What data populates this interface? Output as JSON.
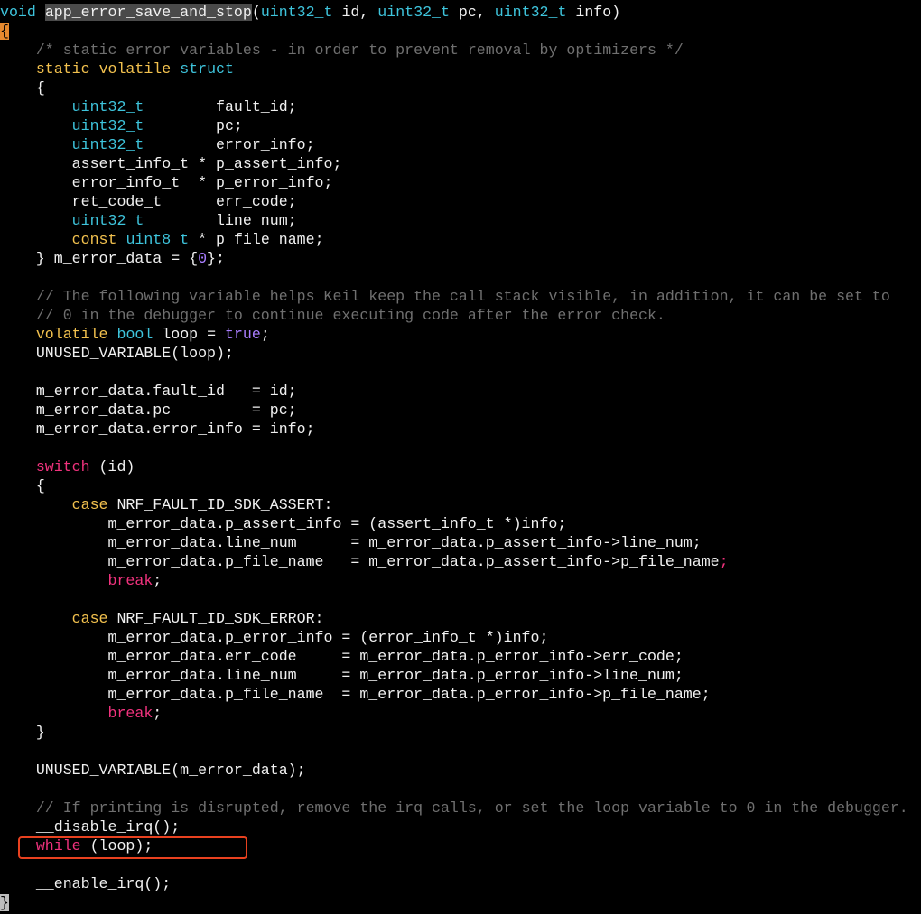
{
  "colors": {
    "background": "#000000",
    "plain": "#f0f0f0",
    "keyword": "#f2c14e",
    "type": "#3ec4dc",
    "control": "#f0327d",
    "comment": "#6f6f6f",
    "constant": "#a97dff",
    "cursor": "#e6892e",
    "annotation_box": "#e8411f"
  },
  "code_lines": [
    [
      [
        "ty",
        "void"
      ],
      [
        "pl",
        " "
      ],
      [
        "fn",
        "app_error_save_and_stop"
      ],
      [
        "pl",
        "("
      ],
      [
        "ty",
        "uint32_t"
      ],
      [
        "pl",
        " id, "
      ],
      [
        "ty",
        "uint32_t"
      ],
      [
        "pl",
        " pc, "
      ],
      [
        "ty",
        "uint32_t"
      ],
      [
        "pl",
        " info)"
      ]
    ],
    [
      [
        "cursor",
        "{"
      ]
    ],
    [
      [
        "pl",
        "    "
      ],
      [
        "cm",
        "/* static error variables - in order to prevent removal by optimizers */"
      ]
    ],
    [
      [
        "pl",
        "    "
      ],
      [
        "kw",
        "static"
      ],
      [
        "pl",
        " "
      ],
      [
        "kw",
        "volatile"
      ],
      [
        "pl",
        " "
      ],
      [
        "ty",
        "struct"
      ]
    ],
    [
      [
        "pl",
        "    {"
      ]
    ],
    [
      [
        "pl",
        "        "
      ],
      [
        "ty",
        "uint32_t"
      ],
      [
        "pl",
        "        fault_id;"
      ]
    ],
    [
      [
        "pl",
        "        "
      ],
      [
        "ty",
        "uint32_t"
      ],
      [
        "pl",
        "        pc;"
      ]
    ],
    [
      [
        "pl",
        "        "
      ],
      [
        "ty",
        "uint32_t"
      ],
      [
        "pl",
        "        error_info;"
      ]
    ],
    [
      [
        "pl",
        "        assert_info_t * p_assert_info;"
      ]
    ],
    [
      [
        "pl",
        "        error_info_t  * p_error_info;"
      ]
    ],
    [
      [
        "pl",
        "        ret_code_t      err_code;"
      ]
    ],
    [
      [
        "pl",
        "        "
      ],
      [
        "ty",
        "uint32_t"
      ],
      [
        "pl",
        "        line_num;"
      ]
    ],
    [
      [
        "pl",
        "        "
      ],
      [
        "kw",
        "const"
      ],
      [
        "pl",
        " "
      ],
      [
        "ty",
        "uint8_t"
      ],
      [
        "pl",
        " * p_file_name;"
      ]
    ],
    [
      [
        "pl",
        "    } m_error_data = {"
      ],
      [
        "ct",
        "0"
      ],
      [
        "pl",
        "};"
      ]
    ],
    [
      [
        "pl",
        ""
      ]
    ],
    [
      [
        "pl",
        "    "
      ],
      [
        "cm",
        "// The following variable helps Keil keep the call stack visible, in addition, it can be set to"
      ]
    ],
    [
      [
        "pl",
        "    "
      ],
      [
        "cm",
        "// 0 in the debugger to continue executing code after the error check."
      ]
    ],
    [
      [
        "pl",
        "    "
      ],
      [
        "kw",
        "volatile"
      ],
      [
        "pl",
        " "
      ],
      [
        "ty",
        "bool"
      ],
      [
        "pl",
        " loop = "
      ],
      [
        "ct",
        "true"
      ],
      [
        "pl",
        ";"
      ]
    ],
    [
      [
        "pl",
        "    UNUSED_VARIABLE(loop);"
      ]
    ],
    [
      [
        "pl",
        ""
      ]
    ],
    [
      [
        "pl",
        "    m_error_data.fault_id   = id;"
      ]
    ],
    [
      [
        "pl",
        "    m_error_data.pc         = pc;"
      ]
    ],
    [
      [
        "pl",
        "    m_error_data.error_info = info;"
      ]
    ],
    [
      [
        "pl",
        ""
      ]
    ],
    [
      [
        "pl",
        "    "
      ],
      [
        "ctl",
        "switch"
      ],
      [
        "pl",
        " (id)"
      ]
    ],
    [
      [
        "pl",
        "    {"
      ]
    ],
    [
      [
        "pl",
        "        "
      ],
      [
        "kw",
        "case"
      ],
      [
        "pl",
        " NRF_FAULT_ID_SDK_ASSERT:"
      ]
    ],
    [
      [
        "pl",
        "            m_error_data.p_assert_info = (assert_info_t *)info;"
      ]
    ],
    [
      [
        "pl",
        "            m_error_data.line_num      = m_error_data.p_assert_info->line_num;"
      ]
    ],
    [
      [
        "pl",
        "            m_error_data.p_file_name   = m_error_data.p_assert_info->p_file_name"
      ],
      [
        "ctl",
        ";"
      ]
    ],
    [
      [
        "pl",
        "            "
      ],
      [
        "ctl",
        "break"
      ],
      [
        "pl",
        ";"
      ]
    ],
    [
      [
        "pl",
        ""
      ]
    ],
    [
      [
        "pl",
        "        "
      ],
      [
        "kw",
        "case"
      ],
      [
        "pl",
        " NRF_FAULT_ID_SDK_ERROR:"
      ]
    ],
    [
      [
        "pl",
        "            m_error_data.p_error_info = (error_info_t *)info;"
      ]
    ],
    [
      [
        "pl",
        "            m_error_data.err_code     = m_error_data.p_error_info->err_code;"
      ]
    ],
    [
      [
        "pl",
        "            m_error_data.line_num     = m_error_data.p_error_info->line_num;"
      ]
    ],
    [
      [
        "pl",
        "            m_error_data.p_file_name  = m_error_data.p_error_info->p_file_name;"
      ]
    ],
    [
      [
        "pl",
        "            "
      ],
      [
        "ctl",
        "break"
      ],
      [
        "pl",
        ";"
      ]
    ],
    [
      [
        "pl",
        "    }"
      ]
    ],
    [
      [
        "pl",
        ""
      ]
    ],
    [
      [
        "pl",
        "    UNUSED_VARIABLE(m_error_data);"
      ]
    ],
    [
      [
        "pl",
        ""
      ]
    ],
    [
      [
        "pl",
        "    "
      ],
      [
        "cm",
        "// If printing is disrupted, remove the irq calls, or set the loop variable to 0 in the debugger."
      ]
    ],
    [
      [
        "pl",
        "    __disable_irq();"
      ]
    ],
    [
      [
        "pl",
        "    "
      ],
      [
        "ctl",
        "while"
      ],
      [
        "pl",
        " (loop);"
      ]
    ],
    [
      [
        "pl",
        ""
      ]
    ],
    [
      [
        "pl",
        "    __enable_irq();"
      ]
    ],
    [
      [
        "cursor2",
        "}"
      ]
    ]
  ]
}
